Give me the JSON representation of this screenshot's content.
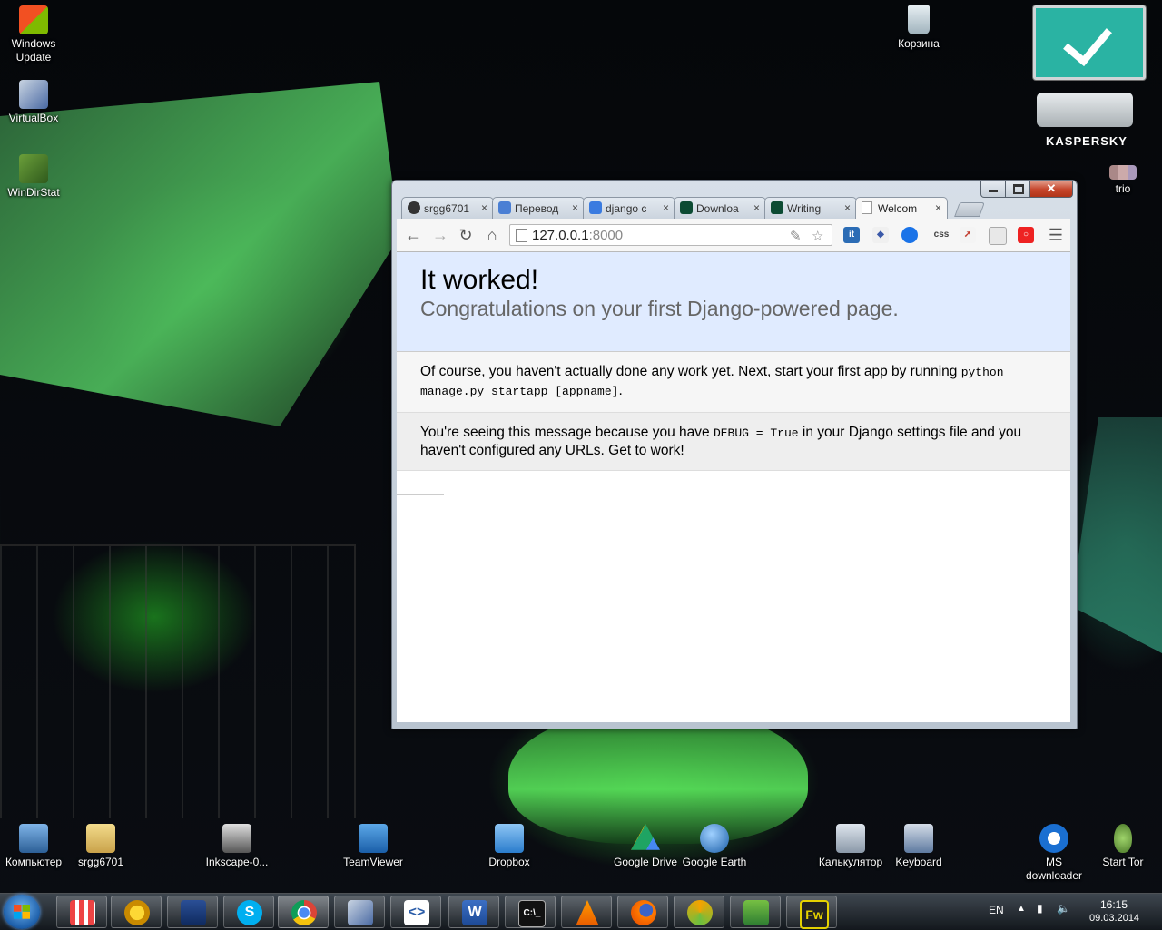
{
  "desktop": {
    "icons_left": [
      {
        "label": "Windows\nUpdate",
        "line1": "Windows",
        "line2": "Update"
      },
      {
        "label": "VirtualBox"
      },
      {
        "label": "WinDirStat"
      }
    ],
    "recycle_bin": "Корзина",
    "trio": "trio",
    "kaspersky_logo": "KASPERSKY",
    "icons_bottom": [
      {
        "label": "Компьютер"
      },
      {
        "label": "srgg6701"
      },
      {
        "label": "Inkscape-0..."
      },
      {
        "label": "TeamViewer"
      },
      {
        "label": "Dropbox"
      },
      {
        "label": "Google Drive"
      },
      {
        "label": "Google Earth"
      },
      {
        "label": "Калькулятор"
      },
      {
        "label": "Keyboard"
      },
      {
        "label": "MS downloader",
        "line1": "MS",
        "line2": "downloader"
      },
      {
        "label": "Start Tor"
      }
    ]
  },
  "browser": {
    "tabs": [
      {
        "title": "srgg6701",
        "icon": "github-icon"
      },
      {
        "title": "Перевод",
        "icon": "translate-icon"
      },
      {
        "title": "django c",
        "icon": "google-icon"
      },
      {
        "title": "Downloa",
        "icon": "django-icon"
      },
      {
        "title": "Writing",
        "icon": "django-icon"
      },
      {
        "title": "Welcom",
        "icon": "page-icon"
      }
    ],
    "close_glyph": "×",
    "window_close_glyph": "✕",
    "address": {
      "host": "127.0.0.1",
      "port": ":8000"
    },
    "extensions": [
      "it",
      "css"
    ]
  },
  "page": {
    "title": "It worked!",
    "subtitle": "Congratulations on your first Django-powered page.",
    "instructions_pre": "Of course, you haven't actually done any work yet. Next, start your first app by running ",
    "instructions_code": "python manage.py startapp [appname]",
    "instructions_post": ".",
    "explanation_pre": "You're seeing this message because you have ",
    "explanation_code": "DEBUG = True",
    "explanation_post": " in your Django settings file and you haven't configured any URLs. Get to work!"
  },
  "taskbar": {
    "language": "EN",
    "time": "16:15",
    "date": "09.03.2014",
    "fw_label": "Fw"
  }
}
